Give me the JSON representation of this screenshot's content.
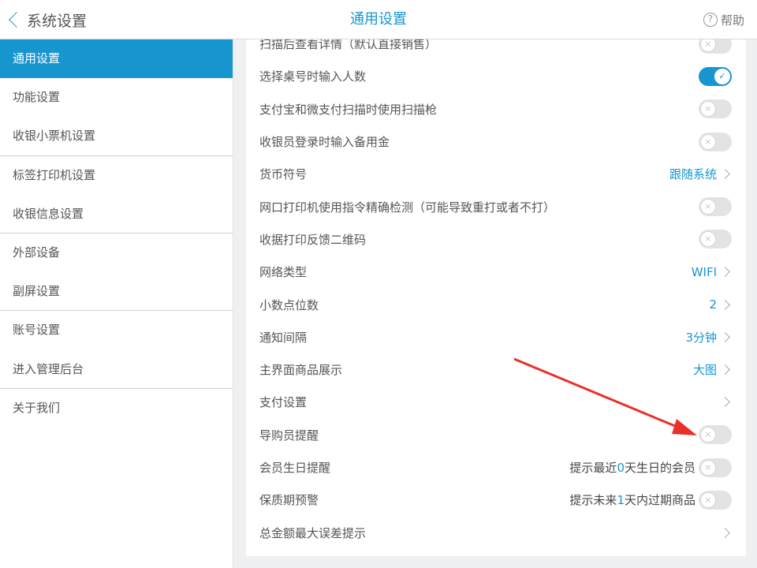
{
  "header": {
    "back_label": "系统设置",
    "title": "通用设置",
    "help_label": "帮助",
    "help_icon_glyph": "?"
  },
  "sidebar": {
    "items": [
      {
        "label": "通用设置",
        "active": true
      },
      {
        "label": "功能设置"
      },
      {
        "label": "收银小票机设置"
      },
      {
        "label": "标签打印机设置"
      },
      {
        "label": "收银信息设置"
      },
      {
        "label": "外部设备"
      },
      {
        "label": "副屏设置"
      },
      {
        "label": "账号设置"
      },
      {
        "label": "进入管理后台"
      },
      {
        "label": "关于我们"
      }
    ]
  },
  "settings": {
    "rows": [
      {
        "label": "扫描后查看详情（默认直接销售）",
        "type": "toggle",
        "on": false
      },
      {
        "label": "选择桌号时输入人数",
        "type": "toggle",
        "on": true
      },
      {
        "label": "支付宝和微支付扫描时使用扫描枪",
        "type": "toggle",
        "on": false
      },
      {
        "label": "收银员登录时输入备用金",
        "type": "toggle",
        "on": false
      },
      {
        "label": "货币符号",
        "type": "link",
        "value": "跟随系统"
      },
      {
        "label": "网口打印机使用指令精确检测（可能导致重打或者不打）",
        "type": "toggle",
        "on": false
      },
      {
        "label": "收据打印反馈二维码",
        "type": "toggle",
        "on": false
      },
      {
        "label": "网络类型",
        "type": "link",
        "value": "WIFI"
      },
      {
        "label": "小数点位数",
        "type": "link",
        "value": "2"
      },
      {
        "label": "通知间隔",
        "type": "link",
        "value": "3分钟"
      },
      {
        "label": "主界面商品展示",
        "type": "link",
        "value": "大图"
      },
      {
        "label": "支付设置",
        "type": "link",
        "value": ""
      },
      {
        "label": "导购员提醒",
        "type": "toggle",
        "on": false
      },
      {
        "label": "会员生日提醒",
        "type": "hint-toggle",
        "on": false,
        "hint_pre": "提示最近",
        "hint_num": "0",
        "hint_post": "天生日的会员"
      },
      {
        "label": "保质期预警",
        "type": "hint-toggle",
        "on": false,
        "hint_pre": "提示未来",
        "hint_num": "1",
        "hint_post": "天内过期商品"
      },
      {
        "label": "总金额最大误差提示",
        "type": "link",
        "value": ""
      }
    ]
  },
  "icons": {
    "toggle_off_glyph": "×",
    "toggle_on_glyph": "✓"
  },
  "colors": {
    "accent": "#1796d0",
    "annotation_arrow": "#e8312b"
  }
}
